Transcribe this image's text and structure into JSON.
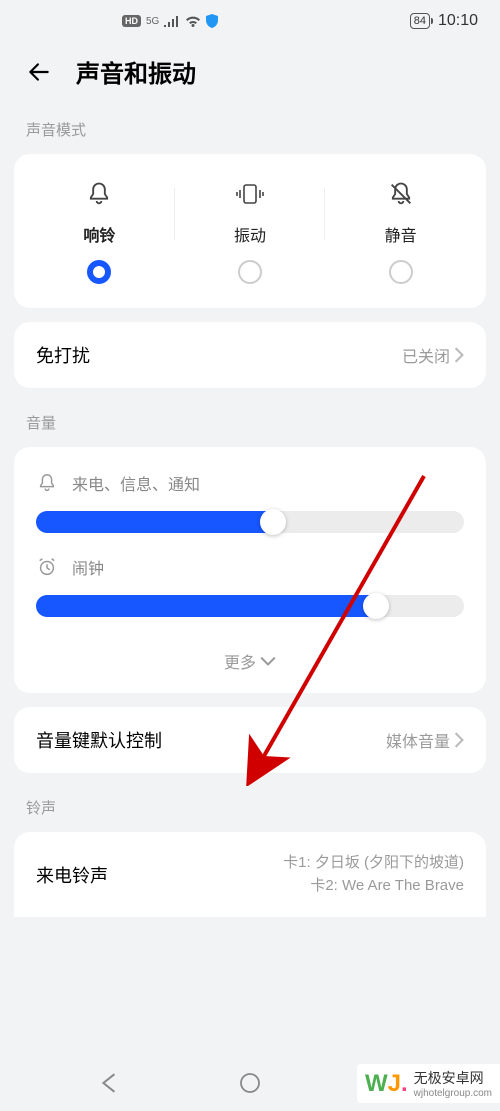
{
  "status": {
    "hd_label": "HD",
    "network": "5G",
    "battery": "84",
    "time": "10:10"
  },
  "header": {
    "title": "声音和振动"
  },
  "sections": {
    "sound_mode": "声音模式",
    "volume": "音量",
    "ringtone": "铃声"
  },
  "modes": {
    "ring": "响铃",
    "vibrate": "振动",
    "silent": "静音",
    "selected": "ring"
  },
  "dnd": {
    "label": "免打扰",
    "value": "已关闭"
  },
  "volume_sliders": {
    "notifications": {
      "label": "来电、信息、通知",
      "percent": 58
    },
    "alarm": {
      "label": "闹钟",
      "percent": 82
    }
  },
  "more_label": "更多",
  "volume_key": {
    "label": "音量键默认控制",
    "value": "媒体音量"
  },
  "ringtone": {
    "label": "来电铃声",
    "line1": "卡1: 夕日坂 (夕阳下的坡道)",
    "line2": "卡2: We Are The Brave"
  },
  "watermark": {
    "name": "无极安卓网",
    "url": "wjhotelgroup.com"
  }
}
